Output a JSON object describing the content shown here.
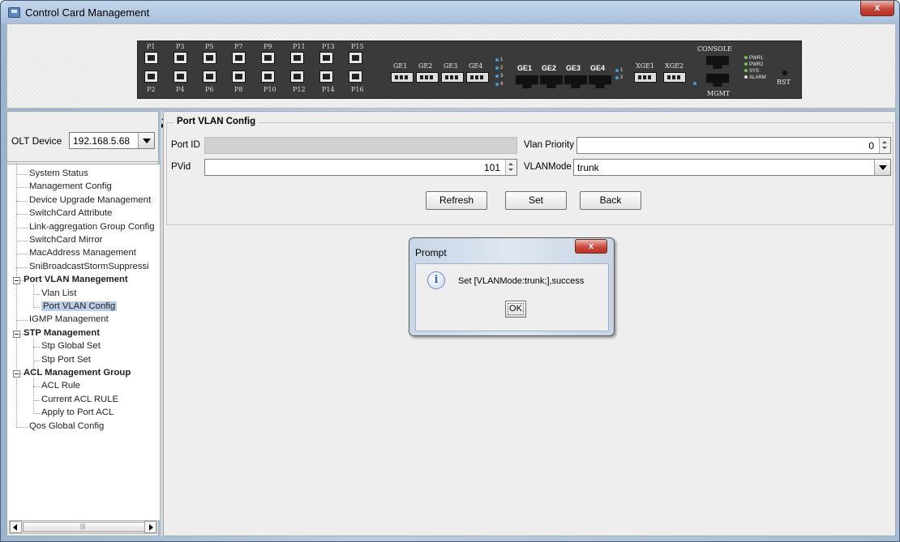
{
  "window": {
    "title": "Control Card Management",
    "close_label": "x"
  },
  "device_panel": {
    "ports_top": [
      "P1",
      "P3",
      "P5",
      "P7",
      "P9",
      "P11",
      "P13",
      "P15"
    ],
    "ports_bottom": [
      "P2",
      "P4",
      "P6",
      "P8",
      "P10",
      "P12",
      "P14",
      "P16"
    ],
    "ge_optical": [
      "GE1",
      "GE2",
      "GE3",
      "GE4"
    ],
    "ge_optical_leds": [
      "1",
      "2",
      "3",
      "4"
    ],
    "ge_electrical": [
      "GE1",
      "GE2",
      "GE3",
      "GE4"
    ],
    "xge": [
      "XGE1",
      "XGE2"
    ],
    "xge_leds": [
      "1",
      "2"
    ],
    "console_label": "CONSOLE",
    "mgmt_label": "MGMT",
    "status_leds": [
      "PWR1",
      "PWR2",
      "SYS",
      "ALARM"
    ],
    "rst_label": "RST"
  },
  "sidebar": {
    "olt_label": "OLT Device",
    "olt_value": "192.168.5.68",
    "tree": [
      {
        "label": "System Status"
      },
      {
        "label": "Management Config"
      },
      {
        "label": "Device Upgrade Management"
      },
      {
        "label": "SwitchCard Attribute"
      },
      {
        "label": "Link-aggregation Group Config"
      },
      {
        "label": "SwitchCard Mirror"
      },
      {
        "label": "MacAddress Management"
      },
      {
        "label": "SniBroadcastStormSuppressi"
      },
      {
        "label": "Port VLAN Manegement"
      },
      {
        "label": "Vlan List"
      },
      {
        "label": "Port VLAN Config"
      },
      {
        "label": "IGMP Management"
      },
      {
        "label": "STP Management"
      },
      {
        "label": "Stp Global Set"
      },
      {
        "label": "Stp Port Set"
      },
      {
        "label": "ACL Management Group"
      },
      {
        "label": "ACL Rule"
      },
      {
        "label": "Current ACL RULE"
      },
      {
        "label": "Apply to Port ACL"
      },
      {
        "label": "Qos Global Config"
      }
    ],
    "scroll_glyph": "|||"
  },
  "form": {
    "group_title": "Port VLAN Config",
    "port_id_label": "Port ID",
    "port_id_value": "",
    "vlan_priority_label": "Vlan Priority",
    "vlan_priority_value": "0",
    "pvid_label": "PVid",
    "pvid_value": "101",
    "vlanmode_label": "VLANMode",
    "vlanmode_value": "trunk",
    "refresh_label": "Refresh",
    "set_label": "Set",
    "back_label": "Back"
  },
  "dialog": {
    "title": "Prompt",
    "close_label": "x",
    "icon_glyph": "i",
    "message": "Set [VLANMode:trunk;],success",
    "ok_label": "OK"
  }
}
